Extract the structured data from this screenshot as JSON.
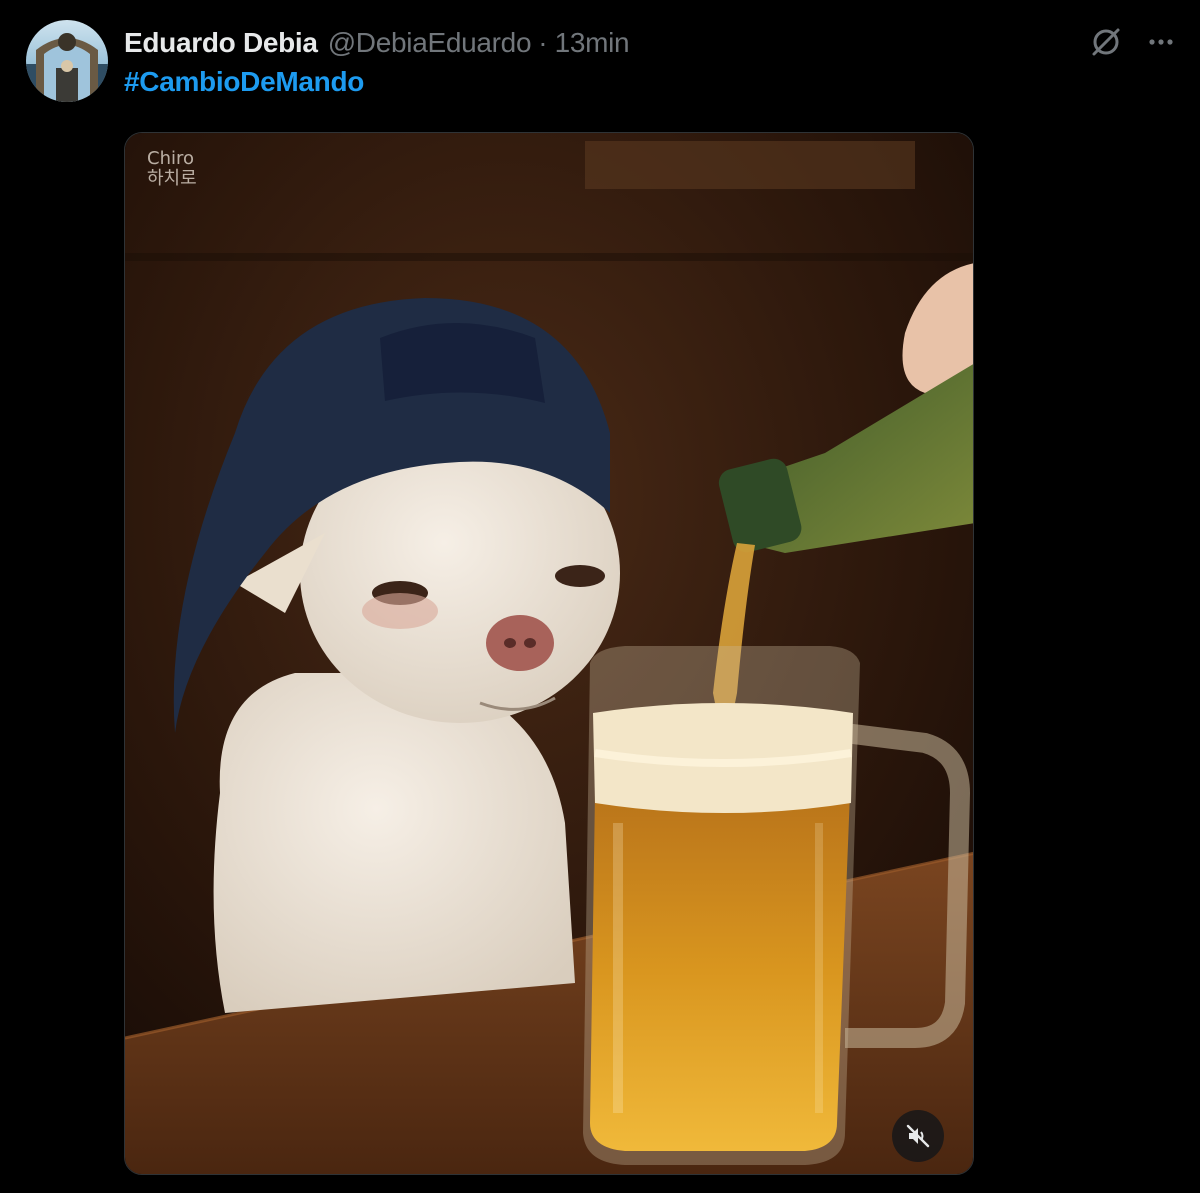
{
  "tweet": {
    "display_name": "Eduardo Debia",
    "handle": "@DebiaEduardo",
    "separator": "·",
    "time": "13min",
    "hashtag": "#CambioDeMando",
    "avatar_icon": "profile-avatar-image",
    "actions": {
      "grok_icon": "grok-icon",
      "more_icon": "more-options-icon"
    },
    "media": {
      "type": "photo",
      "watermark_line1": "Chiro",
      "watermark_line2": "하치로",
      "mute_icon": "volume-muted-icon"
    }
  },
  "colors": {
    "background": "#000000",
    "primary_text": "#e7e9ea",
    "secondary_text": "#71767b",
    "link": "#1d9bf0"
  }
}
